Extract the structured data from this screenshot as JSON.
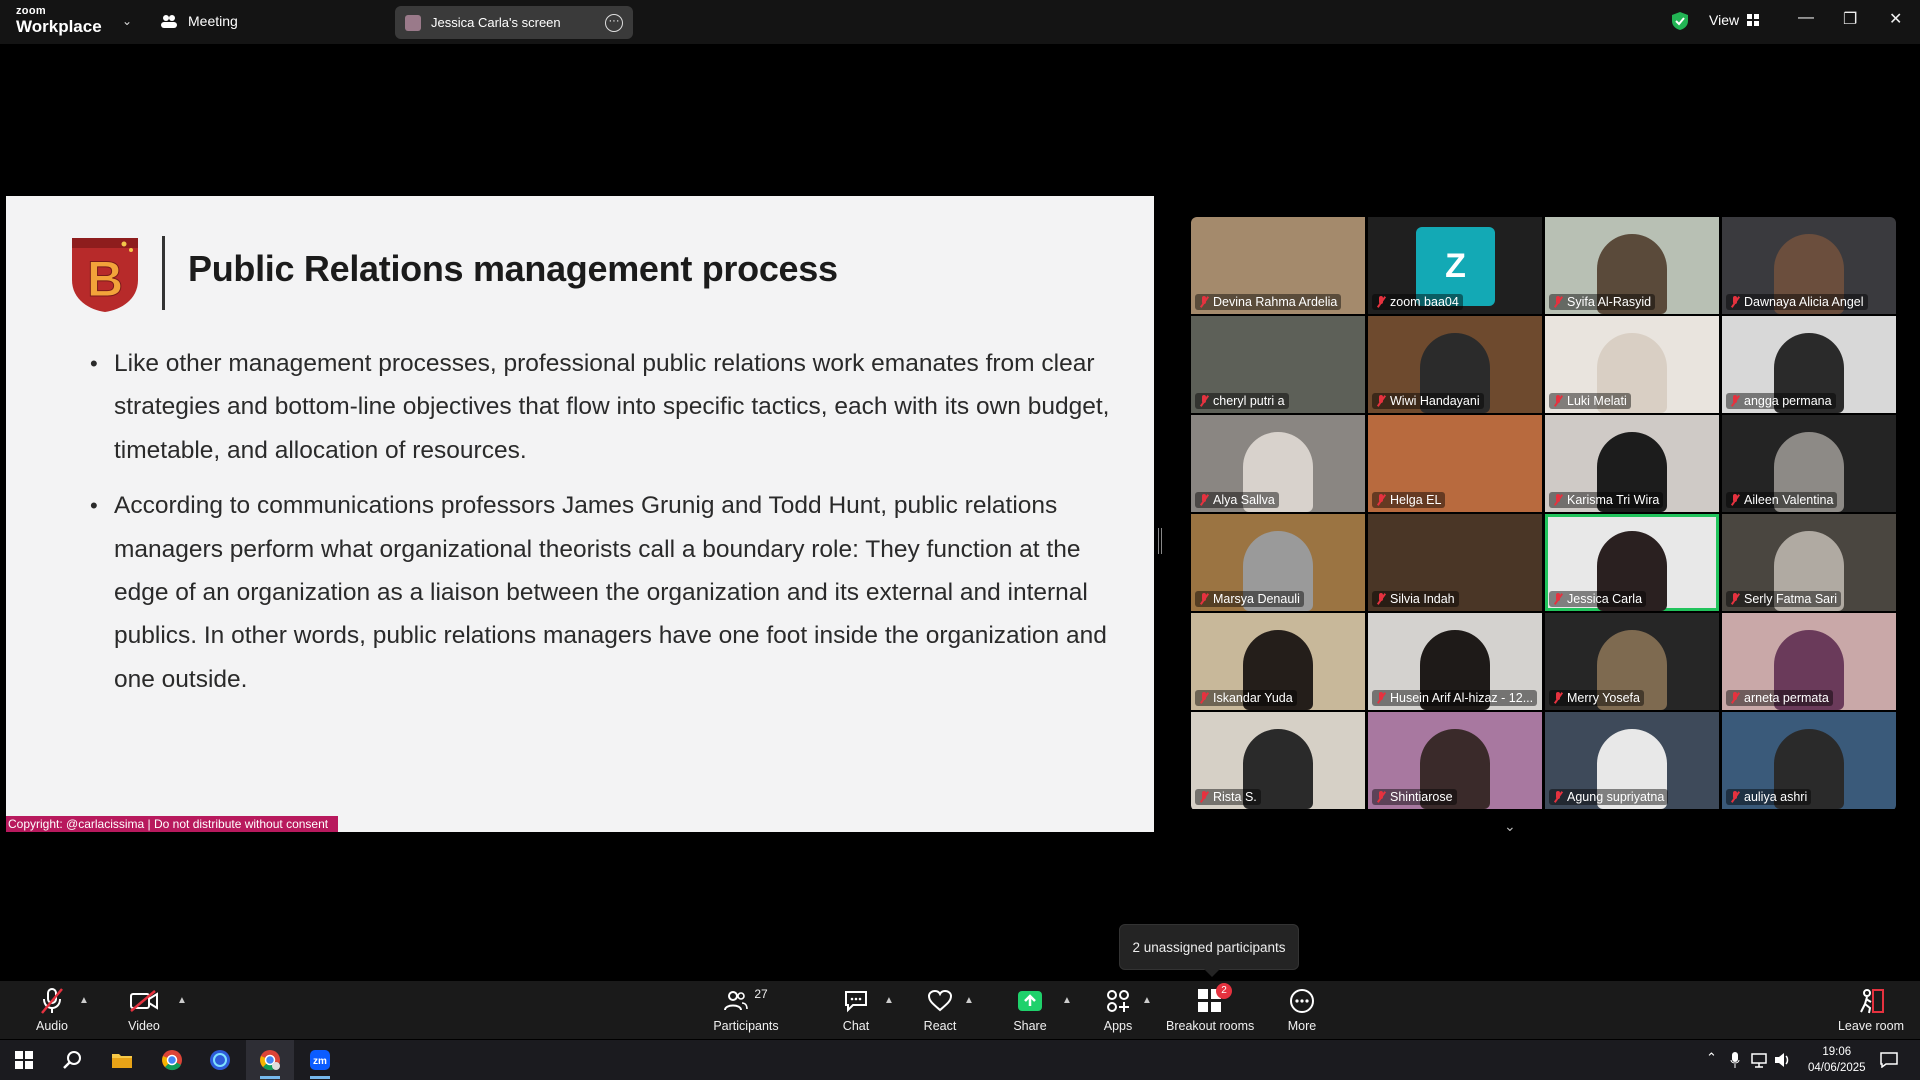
{
  "titlebar": {
    "logo_line1": "zoom",
    "logo_line2": "Workplace",
    "meeting_label": "Meeting",
    "screen_share_label": "Jessica Carla's screen",
    "view_label": "View"
  },
  "slide": {
    "title": "Public Relations management process",
    "logo_letter": "B",
    "bullets": [
      "Like other management processes, professional public relations work emanates from clear strategies and bottom-line objectives that flow into specific tactics, each with its own budget, timetable, and allocation of resources.",
      "According to communications professors James Grunig and Todd Hunt, public relations managers perform what organizational theorists call a boundary role: They function at the edge of an organization as a liaison between the organization and its external and internal publics. In other words, public relations managers have one foot inside the organization and one outside."
    ],
    "copyright": "Copyright: @carlacissima | Do not distribute without consent"
  },
  "gallery": {
    "participants": [
      {
        "name": "Devina Rahma Ardelia",
        "bg": "#a48a6c",
        "person": "none"
      },
      {
        "name": "zoom baa04",
        "bg": "#1f1f1f",
        "avatar": "Z"
      },
      {
        "name": "Syifa Al-Rasyid",
        "bg": "#b8c0b4",
        "person": "#5a4a3a"
      },
      {
        "name": "Dawnaya Alicia Angel",
        "bg": "#3a3a3e",
        "person": "#6b4e3d"
      },
      {
        "name": "cheryl putri a",
        "bg": "#5d6058",
        "person": "none"
      },
      {
        "name": "Wiwi Handayani",
        "bg": "#6e4a2e",
        "person": "#2b2b2b"
      },
      {
        "name": "Luki Melati",
        "bg": "#e9e4de",
        "person": "#d9cfc4"
      },
      {
        "name": "angga permana",
        "bg": "#d8d8d8",
        "person": "#2a2a2a"
      },
      {
        "name": "Alya Sallva",
        "bg": "#8a8682",
        "person": "#d8d2cc"
      },
      {
        "name": "Helga EL",
        "bg": "#b86a3e",
        "person": "none"
      },
      {
        "name": "Karisma Tri Wira",
        "bg": "#cfcac6",
        "person": "#1c1c1c"
      },
      {
        "name": "Aileen Valentina",
        "bg": "#242424",
        "person": "#8d8a86"
      },
      {
        "name": "Marsya Denauli",
        "bg": "#9b7442",
        "person": "#9a9a9a"
      },
      {
        "name": "Silvia Indah",
        "bg": "#4a3626",
        "person": "none"
      },
      {
        "name": "Jessica Carla",
        "bg": "#e8e8e8",
        "person": "#2a2020",
        "active": true
      },
      {
        "name": "Serly Fatma Sari",
        "bg": "#4a4640",
        "person": "#b0aaa2"
      },
      {
        "name": "Iskandar Yuda",
        "bg": "#c8b89a",
        "person": "#241e1a"
      },
      {
        "name": "Husein Arif Al-hizaz - 12...",
        "bg": "#d4d2cf",
        "person": "#1e1a18"
      },
      {
        "name": "Merry Yosefa",
        "bg": "#262626",
        "person": "#7e6a50"
      },
      {
        "name": "arneta permata",
        "bg": "#c9a8a8",
        "person": "#6a3a5a"
      },
      {
        "name": "Rista S.",
        "bg": "#d6d0c6",
        "person": "#2a2a2a"
      },
      {
        "name": "Shintiarose",
        "bg": "#a878a0",
        "person": "#3a2a2a"
      },
      {
        "name": "Agung supriyatna",
        "bg": "#3e4a5a",
        "person": "#e8e8e8"
      },
      {
        "name": "auliya ashri",
        "bg": "#3a5a7a",
        "person": "#2a2a2a"
      }
    ]
  },
  "tooltip": "2 unassigned participants",
  "toolbar": {
    "audio": "Audio",
    "video": "Video",
    "participants": "Participants",
    "participants_count": "27",
    "chat": "Chat",
    "react": "React",
    "share": "Share",
    "apps": "Apps",
    "breakout": "Breakout rooms",
    "breakout_badge": "2",
    "more": "More",
    "leave": "Leave room"
  },
  "taskbar": {
    "time": "19:06",
    "date": "04/06/2025"
  },
  "colors": {
    "accent_green": "#21c35c",
    "mute_red": "#e5323f",
    "share_green": "#1fd16b",
    "brand_pink": "#b8195d"
  }
}
